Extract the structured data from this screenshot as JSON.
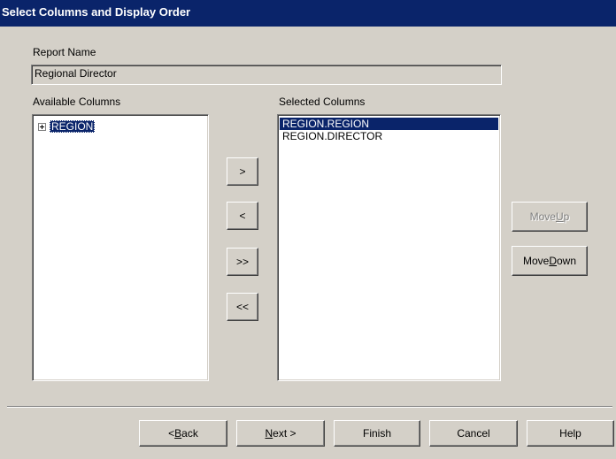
{
  "window": {
    "title": "Select Columns and Display Order"
  },
  "report_name": {
    "label": "Report Name",
    "value": "Regional Director"
  },
  "available_columns": {
    "label": "Available Columns",
    "tree": [
      {
        "label": "REGION",
        "expanded": false,
        "selected": true
      }
    ]
  },
  "selected_columns": {
    "label": "Selected Columns",
    "items": [
      {
        "label": "REGION.REGION",
        "selected": true
      },
      {
        "label": "REGION.DIRECTOR",
        "selected": false
      }
    ]
  },
  "transfer_buttons": {
    "add": ">",
    "remove": "<",
    "add_all": ">>",
    "remove_all": "<<"
  },
  "order_buttons": {
    "move_up": {
      "pre": "Move ",
      "mnemonic": "U",
      "post": "p",
      "enabled": false
    },
    "move_down": {
      "pre": "Move ",
      "mnemonic": "D",
      "post": "own",
      "enabled": true
    }
  },
  "footer_buttons": {
    "back": {
      "pre": "< ",
      "mnemonic": "B",
      "post": "ack"
    },
    "next": {
      "pre": "",
      "mnemonic": "N",
      "post": "ext >"
    },
    "finish": "Finish",
    "cancel": "Cancel",
    "help": "Help"
  },
  "colors": {
    "dialog_bg": "#d4d0c8",
    "title_bg": "#0a246a",
    "selection_bg": "#0a246a",
    "disabled_text": "#808080"
  }
}
